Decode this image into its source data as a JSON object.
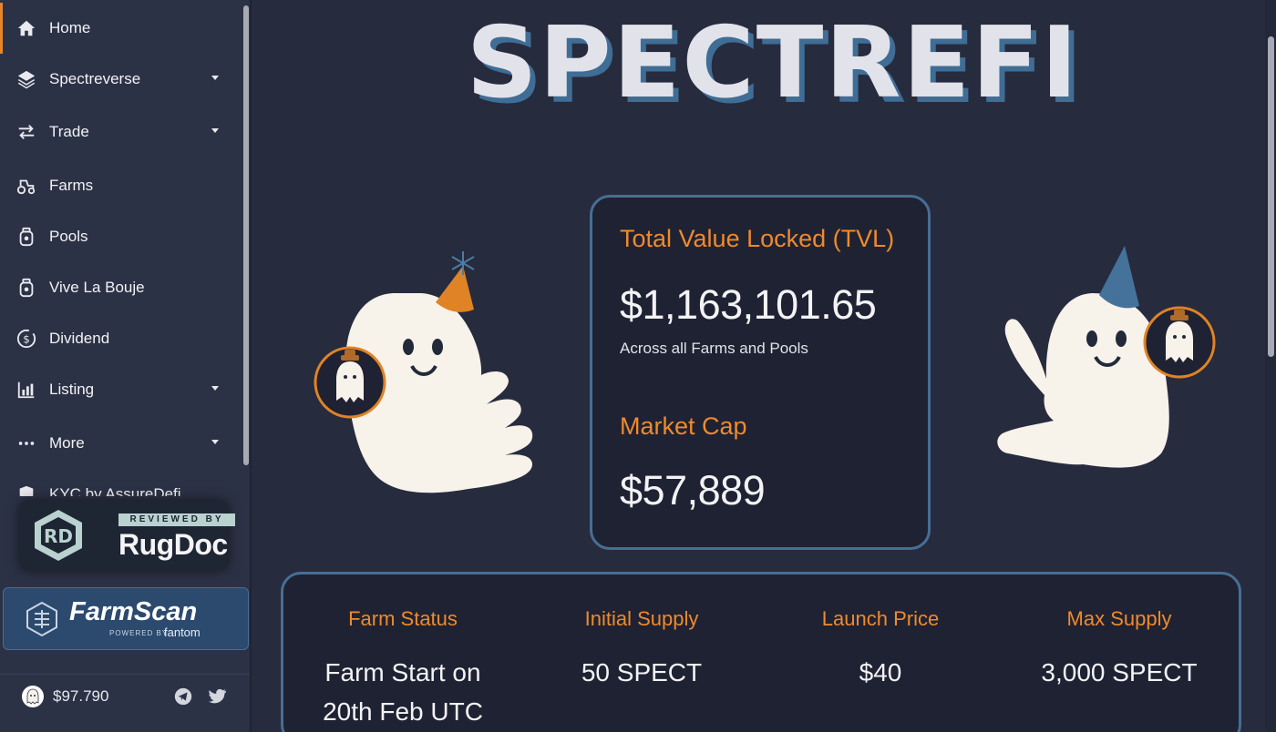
{
  "sidebar": {
    "items": [
      {
        "label": "Home",
        "icon": "home-icon",
        "has_caret": false,
        "active": true
      },
      {
        "label": "Spectreverse",
        "icon": "layers-icon",
        "has_caret": true
      },
      {
        "label": "Trade",
        "icon": "swap-arrows-icon",
        "has_caret": true
      },
      {
        "label": "Farms",
        "icon": "tractor-icon",
        "has_caret": false
      },
      {
        "label": "Pools",
        "icon": "jar-icon",
        "has_caret": false
      },
      {
        "label": "Vive La Bouje",
        "icon": "jar-icon",
        "has_caret": false
      },
      {
        "label": "Dividend",
        "icon": "dollar-circle-icon",
        "has_caret": false
      },
      {
        "label": "Listing",
        "icon": "bar-chart-icon",
        "has_caret": true
      },
      {
        "label": "More",
        "icon": "more-dots-icon",
        "has_caret": true
      },
      {
        "label": "KYC by AssureDefi",
        "icon": "shield-check-icon",
        "has_caret": false
      }
    ],
    "rugdoc": {
      "reviewed_by": "REVIEWED BY",
      "name": "RugDoc"
    },
    "farmscan": {
      "name": "FarmScan",
      "powered_by": "POWERED BY",
      "partner": "fantom"
    },
    "footer": {
      "price": "$97.790"
    }
  },
  "main": {
    "brand_title": "SPECTREFI",
    "tvl": {
      "label": "Total Value Locked (TVL)",
      "value": "$1,163,101.65",
      "subtitle": "Across all Farms and Pools"
    },
    "market_cap": {
      "label": "Market Cap",
      "value": "$57,889"
    },
    "stats": [
      {
        "label": "Farm Status",
        "value": "Farm Start on 20th Feb UTC"
      },
      {
        "label": "Initial Supply",
        "value": "50 SPECT"
      },
      {
        "label": "Launch Price",
        "value": "$40"
      },
      {
        "label": "Max Supply",
        "value": "3,000 SPECT"
      }
    ]
  },
  "colors": {
    "accent": "#ef8a2c",
    "background": "#272b3e",
    "sidebar": "#2c3246",
    "card": "#1f2232",
    "card_border": "#476e95"
  }
}
